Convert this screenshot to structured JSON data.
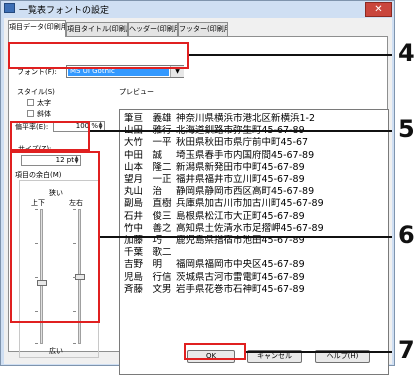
{
  "window": {
    "title": "一覧表フォントの設定",
    "close_glyph": "✕"
  },
  "tabs": [
    {
      "label": "項目データ(印刷用)",
      "active": true
    },
    {
      "label": "項目タイトル(印刷用)",
      "active": false
    },
    {
      "label": "ヘッダー(印刷用)",
      "active": false
    },
    {
      "label": "フッター(印刷用)",
      "active": false
    }
  ],
  "font": {
    "label": "フォント(F):",
    "value": "MS UI Gothic",
    "dropdown_glyph": "▼"
  },
  "style": {
    "group_label": "スタイル(S)",
    "bold_label": "太字",
    "italic_label": "斜体",
    "width_label": "偏平率(E):",
    "width_value": "100 %",
    "size_label": "サイズ(Z):",
    "size_value": "12 pt"
  },
  "margins": {
    "group_label": "項目の余白(M)",
    "narrow_label": "狭い",
    "wide_label": "広い",
    "vertical_label": "上下",
    "horizontal_label": "左右",
    "vertical_level": 0.55,
    "horizontal_level": 0.5
  },
  "preview": {
    "label": "プレビュー",
    "rows": [
      {
        "name": "筆亘　義雄",
        "address": "神奈川県横浜市港北区新横浜1-2"
      },
      {
        "name": "山田　雅行",
        "address": "北海道釧路市弥生町45-67-89"
      },
      {
        "name": "大竹　一平",
        "address": "秋田県秋田市県庁前中町45-67"
      },
      {
        "name": "中田　誠",
        "address": "埼玉県春手市内国府間45-67-89"
      },
      {
        "name": "山本　隆二",
        "address": "新潟県新発田市中町45-67-89"
      },
      {
        "name": "望月　一正",
        "address": "福井県福井市立川町45-67-89"
      },
      {
        "name": "丸山　治",
        "address": "静岡県静岡市西区高町45-67-89"
      },
      {
        "name": "副島　直樹",
        "address": "兵庫県加古川市加古川町45-67-89"
      },
      {
        "name": "石井　俊三",
        "address": "島根県松江市大正町45-67-89"
      },
      {
        "name": "竹中　善之",
        "address": "高知県土佐清水市足摺岬45-67-89"
      },
      {
        "name": "加藤　巧",
        "address": "鹿児島県指宿市池田45-67-89"
      },
      {
        "name": "千葉　歌二",
        "address": ""
      },
      {
        "name": "吉野　明",
        "address": "福岡県福岡市中央区45-67-89"
      },
      {
        "name": "児島　行信",
        "address": "茨城県古河市雷電町45-67-89"
      },
      {
        "name": "斉藤　文男",
        "address": "岩手県花巻市石神町45-67-89"
      }
    ]
  },
  "buttons": {
    "ok": "OK",
    "cancel": "キャンセル",
    "help": "ヘルプ(H)"
  },
  "callouts": [
    "4",
    "5",
    "6",
    "7"
  ],
  "colors": {
    "highlight": "#3399ff",
    "callout_box": "#e02020"
  }
}
